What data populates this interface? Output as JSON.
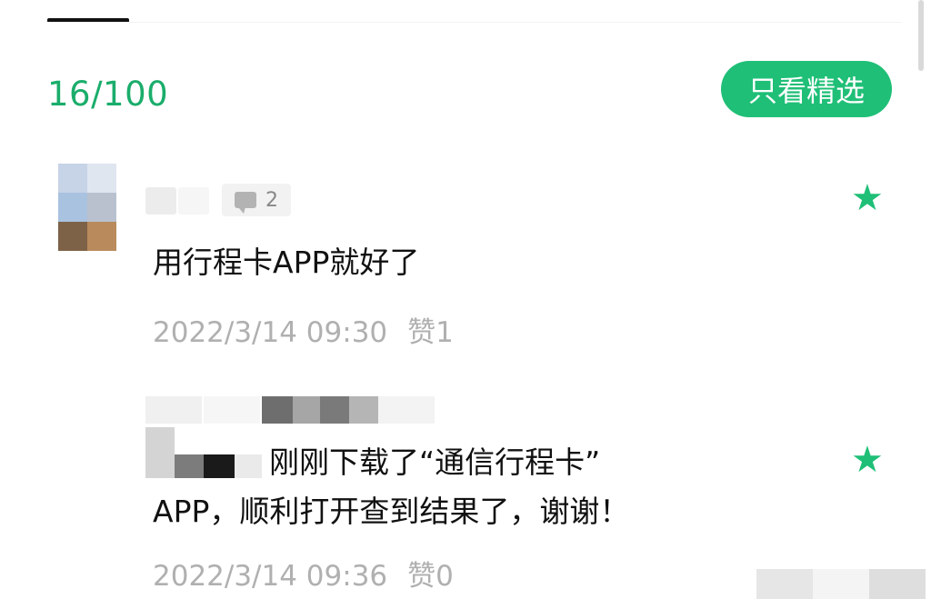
{
  "header": {
    "count": "16/100",
    "filter_button": "只看精选"
  },
  "comments": [
    {
      "reply_count": "2",
      "text": "用行程卡APP就好了",
      "date": "2022/3/14 09:30",
      "likes": "赞1",
      "featured_icon": "star-icon"
    },
    {
      "text_line1": "刚刚下载了“通信行程卡”",
      "text_line2": "APP，顺利打开查到结果了，谢谢！",
      "date": "2022/3/14 09:36",
      "likes": "赞0",
      "featured_icon": "star-icon"
    }
  ],
  "colors": {
    "accent": "#1fbf77",
    "count_text": "#1aad6b",
    "meta_text": "#b0b0b0"
  }
}
